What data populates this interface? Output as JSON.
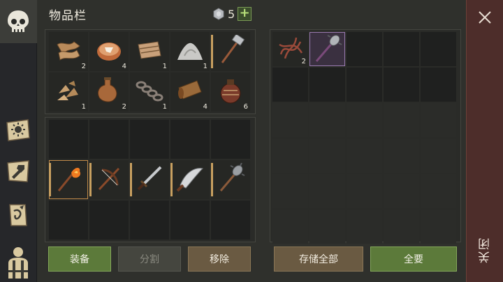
{
  "window": {
    "title": "物品栏"
  },
  "currency": {
    "count": "5",
    "add_label": "+"
  },
  "inventory": {
    "resources": [
      {
        "icon": "leather-scraps-icon",
        "count": "2"
      },
      {
        "icon": "pie-icon",
        "count": "4"
      },
      {
        "icon": "cloth-roll-icon",
        "count": "1"
      },
      {
        "icon": "powder-pile-icon",
        "count": "1"
      },
      {
        "icon": "sledgehammer-icon",
        "count": ""
      },
      {
        "icon": "wood-chips-icon",
        "count": "1"
      },
      {
        "icon": "flask-icon",
        "count": "2"
      },
      {
        "icon": "chain-icon",
        "count": "1"
      },
      {
        "icon": "leather-roll-icon",
        "count": "4"
      },
      {
        "icon": "bomb-pot-icon",
        "count": "6"
      }
    ],
    "weapons": [
      {
        "icon": "flame-torch-icon",
        "count": ""
      },
      {
        "icon": "crossbow-icon",
        "count": ""
      },
      {
        "icon": "sword-icon",
        "count": ""
      },
      {
        "icon": "curved-blade-icon",
        "count": ""
      },
      {
        "icon": "spiked-mace-icon",
        "count": ""
      }
    ]
  },
  "storage": {
    "items": [
      {
        "icon": "twisted-roots-icon",
        "count": "2"
      },
      {
        "icon": "spiked-mace-icon",
        "count": ""
      }
    ]
  },
  "buttons": {
    "equip": "装备",
    "split": "分割",
    "remove": "移除",
    "store_all": "存储全部",
    "take_all": "全要",
    "close": "关闭"
  },
  "colors": {
    "accent_green": "#5c7a3a",
    "close_column": "#4d2d2a",
    "weapon_bar": "#c8a060"
  }
}
